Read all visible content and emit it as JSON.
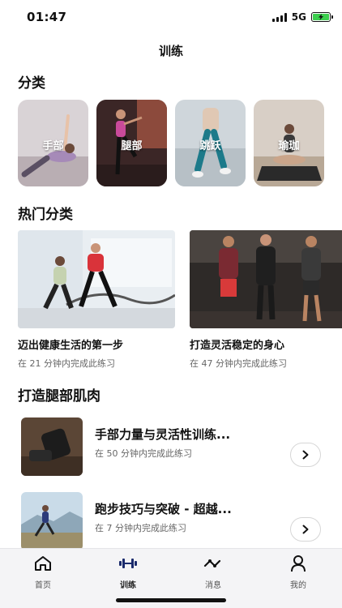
{
  "status": {
    "time": "01:47",
    "network": "5G"
  },
  "title": "训练",
  "categories_section": {
    "title": "分类",
    "items": [
      {
        "label": "手部"
      },
      {
        "label": "腿部"
      },
      {
        "label": "跳跃"
      },
      {
        "label": "瑜珈"
      }
    ]
  },
  "popular_section": {
    "title": "热门分类",
    "items": [
      {
        "title": "迈出健康生活的第一步",
        "subtitle": "在 21 分钟内完成此练习"
      },
      {
        "title": "打造灵活稳定的身心",
        "subtitle": "在 47 分钟内完成此练习"
      }
    ]
  },
  "legs_section": {
    "title": "打造腿部肌肉",
    "items": [
      {
        "title": "手部力量与灵活性训练...",
        "subtitle": "在 50 分钟内完成此练习"
      },
      {
        "title": "跑步技巧与突破 - 超越...",
        "subtitle": "在 7 分钟内完成此练习"
      }
    ]
  },
  "tabs": [
    {
      "label": "首页",
      "icon": "home-icon"
    },
    {
      "label": "训练",
      "icon": "dumbbell-icon"
    },
    {
      "label": "消息",
      "icon": "activity-icon"
    },
    {
      "label": "我的",
      "icon": "user-icon"
    }
  ],
  "colors": {
    "accent": "#1a2a6c",
    "battery": "#3ccf4e",
    "tab_bg": "#f4f4f6"
  }
}
